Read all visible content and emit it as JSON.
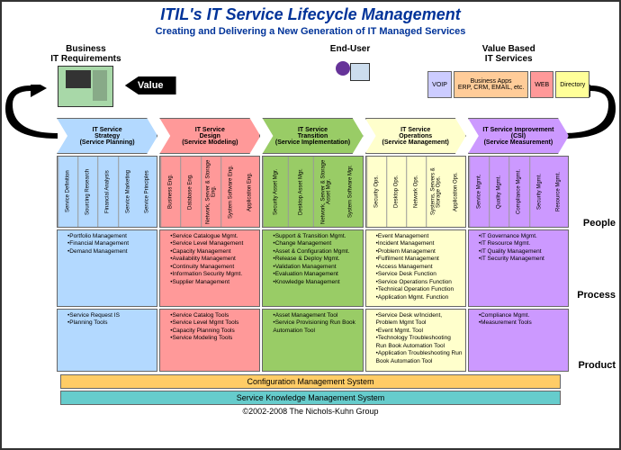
{
  "title": "ITIL's IT Service Lifecycle Management",
  "subtitle": "Creating and Delivering a New Generation of IT Managed Services",
  "top": {
    "biz": "Business\nIT Requirements",
    "value": "Value",
    "enduser": "End-User",
    "valuesvc": "Value Based\nIT Services",
    "voip": "VOIP",
    "apps": "Business Apps\nERP, CRM, EMAIL, etc.",
    "web": "WEB",
    "dir": "Directory"
  },
  "side": {
    "people": "People",
    "process": "Process",
    "product": "Product"
  },
  "cols": [
    {
      "chev": "IT Service\nStrategy\n(Service Planning)",
      "people": [
        "Service Definition",
        "Sourcing Research",
        "Financial Analysis",
        "Service Marketing",
        "Service Principles"
      ],
      "process": [
        "Portfolio Management",
        "Financial Management",
        "Demand Management"
      ],
      "product": [
        "Service Request IS",
        "Planning Tools"
      ]
    },
    {
      "chev": "IT Service\nDesign\n(Service Modeling)",
      "people": [
        "Business Eng.",
        "Database Eng.",
        "Network, Server & Storage Eng.",
        "System Software Eng.",
        "Application Eng."
      ],
      "process": [
        "Service Catalogue Mgmt.",
        "Service Level Management",
        "Capacity Management",
        "Availability Management",
        "Continuity Management",
        "Information Security Mgmt.",
        "Supplier Management"
      ],
      "product": [
        "Service Catalog Tools",
        "Service Level Mgmt Tools",
        "Capacity Planning Tools",
        "Service Modeling Tools"
      ]
    },
    {
      "chev": "IT Service\nTransition\n(Service Implementation)",
      "people": [
        "Security Asset Mgr.",
        "Desktop Asset Mgr.",
        "Network, Server & Storage Asset Mgr.",
        "System Software Mgr."
      ],
      "process": [
        "Support & Transition Mgmt.",
        "Change Management",
        "Asset & Configuration Mgmt.",
        "Release & Deploy Mgmt.",
        "Validation Management",
        "Evaluation Management",
        "Knowledge Management"
      ],
      "product": [
        "Asset Management Tool",
        "Service Provisioning Run Book Automation Tool"
      ]
    },
    {
      "chev": "IT Service\nOperations\n(Service Management)",
      "people": [
        "Security Ops.",
        "Desktop Ops.",
        "Network Ops.",
        "Systems, Servers & Storage Ops.",
        "Application Ops."
      ],
      "process": [
        "Event Management",
        "Incident Management",
        "Problem Management",
        "Fulfilment Management",
        "Access Management",
        "Service Desk Function",
        "Service Operations Function",
        "Technical Operation Function",
        "Application Mgmt. Function"
      ],
      "product": [
        "Service Desk w/Incident, Problem Mgmt Tool",
        "Event Mgmt. Tool",
        "Technology Troubleshooting Run Book Automation Tool",
        "Application Troubleshooting Run Book Automation Tool"
      ]
    },
    {
      "chev": "IT Service Improvement\n(CSI)\n(Service Measurement)",
      "people": [
        "Service Mgmt.",
        "Quality Mgmt.",
        "Compliance Mgmt.",
        "Security Mgmt.",
        "Resource Mgmt."
      ],
      "process": [
        "IT Governance Mgmt.",
        "IT Resource Mgmt.",
        "IT Quality Management",
        "IT Security Management"
      ],
      "product": [
        "Compliance Mgmt.",
        "Measurement Tools"
      ]
    }
  ],
  "bars": {
    "config": "Configuration Management System",
    "skms": "Service Knowledge Management System"
  },
  "footer": "©2002-2008 The Nichols-Kuhn Group"
}
